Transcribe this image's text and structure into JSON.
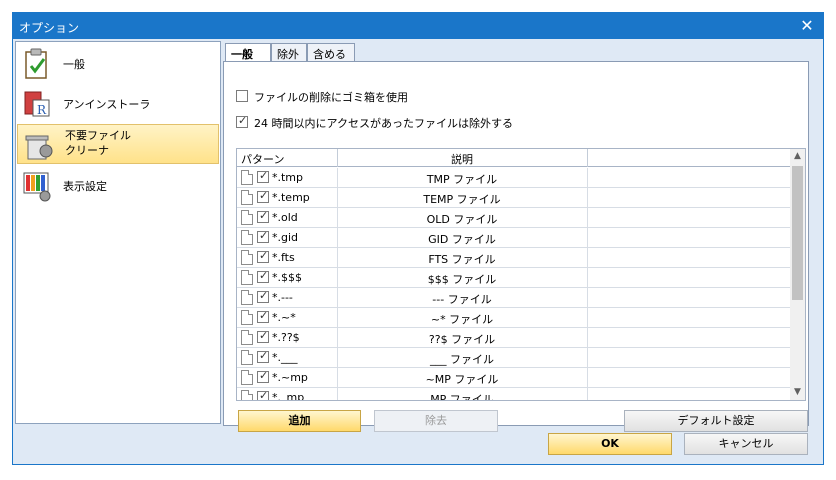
{
  "window": {
    "title": "オプション"
  },
  "sidebar": {
    "items": [
      {
        "label": "一般",
        "icon": "clipboard-check-icon",
        "selected": false
      },
      {
        "label": "アンインストーラ",
        "icon": "uninstaller-icon",
        "selected": false
      },
      {
        "label": "不要ファイルクリーナ",
        "line1": "不要ファイル",
        "line2": "クリーナ",
        "icon": "trash-cleaner-icon",
        "selected": true
      },
      {
        "label": "表示設定",
        "icon": "display-settings-icon",
        "selected": false
      }
    ]
  },
  "tabs": [
    {
      "label": "一般",
      "active": true
    },
    {
      "label": "除外",
      "active": false
    },
    {
      "label": "含める",
      "active": false
    }
  ],
  "options": {
    "use_recycle_bin": {
      "label": "ファイルの削除にゴミ箱を使用",
      "checked": false
    },
    "exclude_recent": {
      "label": "24 時間以内にアクセスがあったファイルは除外する",
      "checked": true
    }
  },
  "grid": {
    "columns": [
      "パターン",
      "説明"
    ],
    "rows": [
      {
        "pattern": "*.tmp",
        "desc": "TMP ファイル",
        "checked": true
      },
      {
        "pattern": "*.temp",
        "desc": "TEMP ファイル",
        "checked": true
      },
      {
        "pattern": "*.old",
        "desc": "OLD ファイル",
        "checked": true
      },
      {
        "pattern": "*.gid",
        "desc": "GID ファイル",
        "checked": true
      },
      {
        "pattern": "*.fts",
        "desc": "FTS ファイル",
        "checked": true
      },
      {
        "pattern": "*.$$$",
        "desc": "$$$ ファイル",
        "checked": true
      },
      {
        "pattern": "*.---",
        "desc": "--- ファイル",
        "checked": true
      },
      {
        "pattern": "*.~*",
        "desc": "~* ファイル",
        "checked": true
      },
      {
        "pattern": "*.??$",
        "desc": "??$ ファイル",
        "checked": true
      },
      {
        "pattern": "*.___",
        "desc": "___ ファイル",
        "checked": true
      },
      {
        "pattern": "*.~mp",
        "desc": "~MP ファイル",
        "checked": true
      },
      {
        "pattern": "*._mp",
        "desc": "MP ファイル",
        "checked": true
      }
    ]
  },
  "buttons": {
    "add": "追加",
    "remove": "除去",
    "default_settings": "デフォルト設定",
    "ok": "OK",
    "cancel": "キャンセル"
  },
  "colors": {
    "titlebar": "#1a76c9",
    "dialog_bg": "#dfe9f5",
    "selection": "#ffe28a"
  }
}
